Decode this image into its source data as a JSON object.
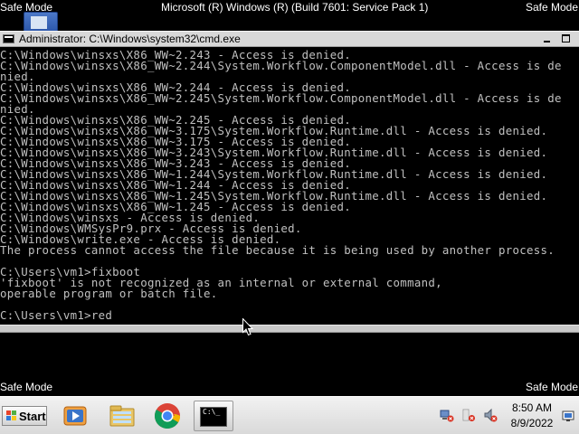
{
  "desktop": {
    "background_color": "#000000",
    "safe_mode_label": "Safe Mode",
    "build_info": "Microsoft (R) Windows (R) (Build 7601: Service Pack 1)"
  },
  "cmd_window": {
    "title": "Administrator: C:\\Windows\\system32\\cmd.exe",
    "text_color": "#c0c0c0",
    "background_color": "#000000",
    "lines": [
      "C:\\Windows\\winsxs\\X86_WW~2.243 - Access is denied.",
      "C:\\Windows\\winsxs\\X86_WW~2.244\\System.Workflow.ComponentModel.dll - Access is de",
      "nied.",
      "C:\\Windows\\winsxs\\X86_WW~2.244 - Access is denied.",
      "C:\\Windows\\winsxs\\X86_WW~2.245\\System.Workflow.ComponentModel.dll - Access is de",
      "nied.",
      "C:\\Windows\\winsxs\\X86_WW~2.245 - Access is denied.",
      "C:\\Windows\\winsxs\\X86_WW~3.175\\System.Workflow.Runtime.dll - Access is denied.",
      "C:\\Windows\\winsxs\\X86_WW~3.175 - Access is denied.",
      "C:\\Windows\\winsxs\\X86_WW~3.243\\System.Workflow.Runtime.dll - Access is denied.",
      "C:\\Windows\\winsxs\\X86_WW~3.243 - Access is denied.",
      "C:\\Windows\\winsxs\\X86_WW~1.244\\System.Workflow.Runtime.dll - Access is denied.",
      "C:\\Windows\\winsxs\\X86_WW~1.244 - Access is denied.",
      "C:\\Windows\\winsxs\\X86_WW~1.245\\System.Workflow.Runtime.dll - Access is denied.",
      "C:\\Windows\\winsxs\\X86_WW~1.245 - Access is denied.",
      "C:\\Windows\\winsxs - Access is denied.",
      "C:\\Windows\\WMSysPr9.prx - Access is denied.",
      "C:\\Windows\\write.exe - Access is denied.",
      "The process cannot access the file because it is being used by another process.",
      "",
      "C:\\Users\\vm1>fixboot",
      "'fixboot' is not recognized as an internal or external command,",
      "operable program or batch file.",
      "",
      "C:\\Users\\vm1>red"
    ]
  },
  "taskbar": {
    "start_label": "Start",
    "apps": [
      {
        "icon": "media-player-icon"
      },
      {
        "icon": "windows-explorer-icon"
      },
      {
        "icon": "chrome-icon"
      },
      {
        "icon": "command-prompt-icon",
        "glyph": "C:\\_"
      }
    ],
    "tray_icons": [
      "network-error-icon",
      "action-center-error-icon",
      "volume-muted-icon"
    ],
    "clock": {
      "time": "8:50 AM",
      "date": "8/9/2022"
    }
  }
}
